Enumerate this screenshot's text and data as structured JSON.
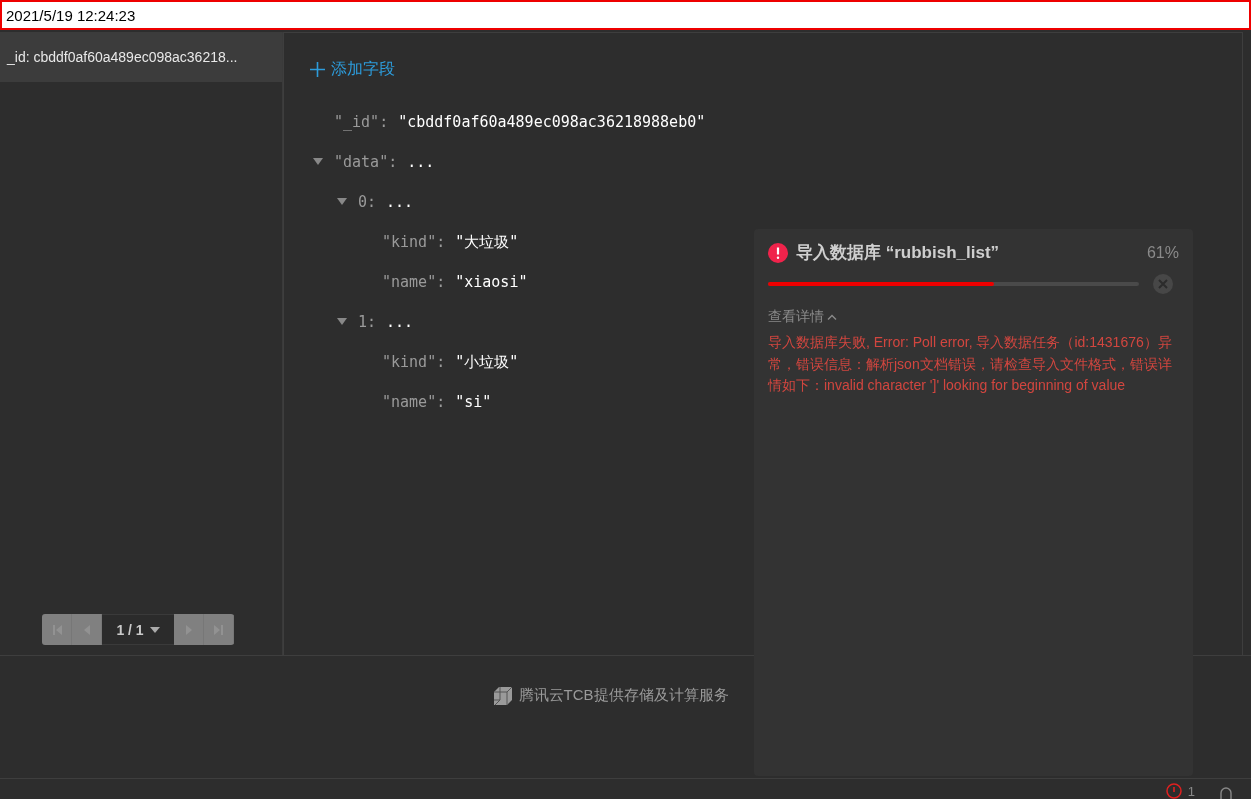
{
  "time_field": {
    "value": "2021/5/19 12:24:23"
  },
  "records": [
    {
      "label": "_id: cbddf0af60a489ec098ac36218...",
      "selected": true
    }
  ],
  "pagination": {
    "first": {
      "disabled": true
    },
    "prev": {
      "disabled": true
    },
    "page": "1 / 1",
    "next": {
      "disabled": true
    },
    "last": {
      "disabled": true
    }
  },
  "add_field": "添加字段",
  "tree": [
    {
      "key": "\"_id\":",
      "value": "\"cbddf0af60a489ec098ac36218988eb0\""
    },
    {
      "key": "\"data\":",
      "value": "...",
      "expanded": true,
      "children": [
        {
          "key": "0:",
          "value": "...",
          "expanded": true,
          "children": [
            {
              "key": "\"kind\":",
              "value": "\"大垃圾\""
            },
            {
              "key": "\"name\":",
              "value": "\"xiaosi\""
            }
          ]
        },
        {
          "key": "1:",
          "value": "...",
          "expanded": true,
          "children": [
            {
              "key": "\"kind\":",
              "value": "\"小垃圾\""
            },
            {
              "key": "\"name\":",
              "value": "\"si\""
            }
          ]
        }
      ]
    }
  ],
  "footer": "腾讯云TCB提供存储及计算服务",
  "status_bar": {
    "count": "1"
  },
  "notification": {
    "title": "导入数据库 “rubbish_list”",
    "percent": "61%",
    "level": 0.61,
    "details_toggle": "查看详情",
    "details_expanded": true,
    "error": "导入数据库失败, Error: Poll error, 导入数据任务（id:1431676）异常，错误信息：解析json文档错误，请检查导入文件格式，错误详情如下：invalid character ']' looking for beginning of value"
  }
}
